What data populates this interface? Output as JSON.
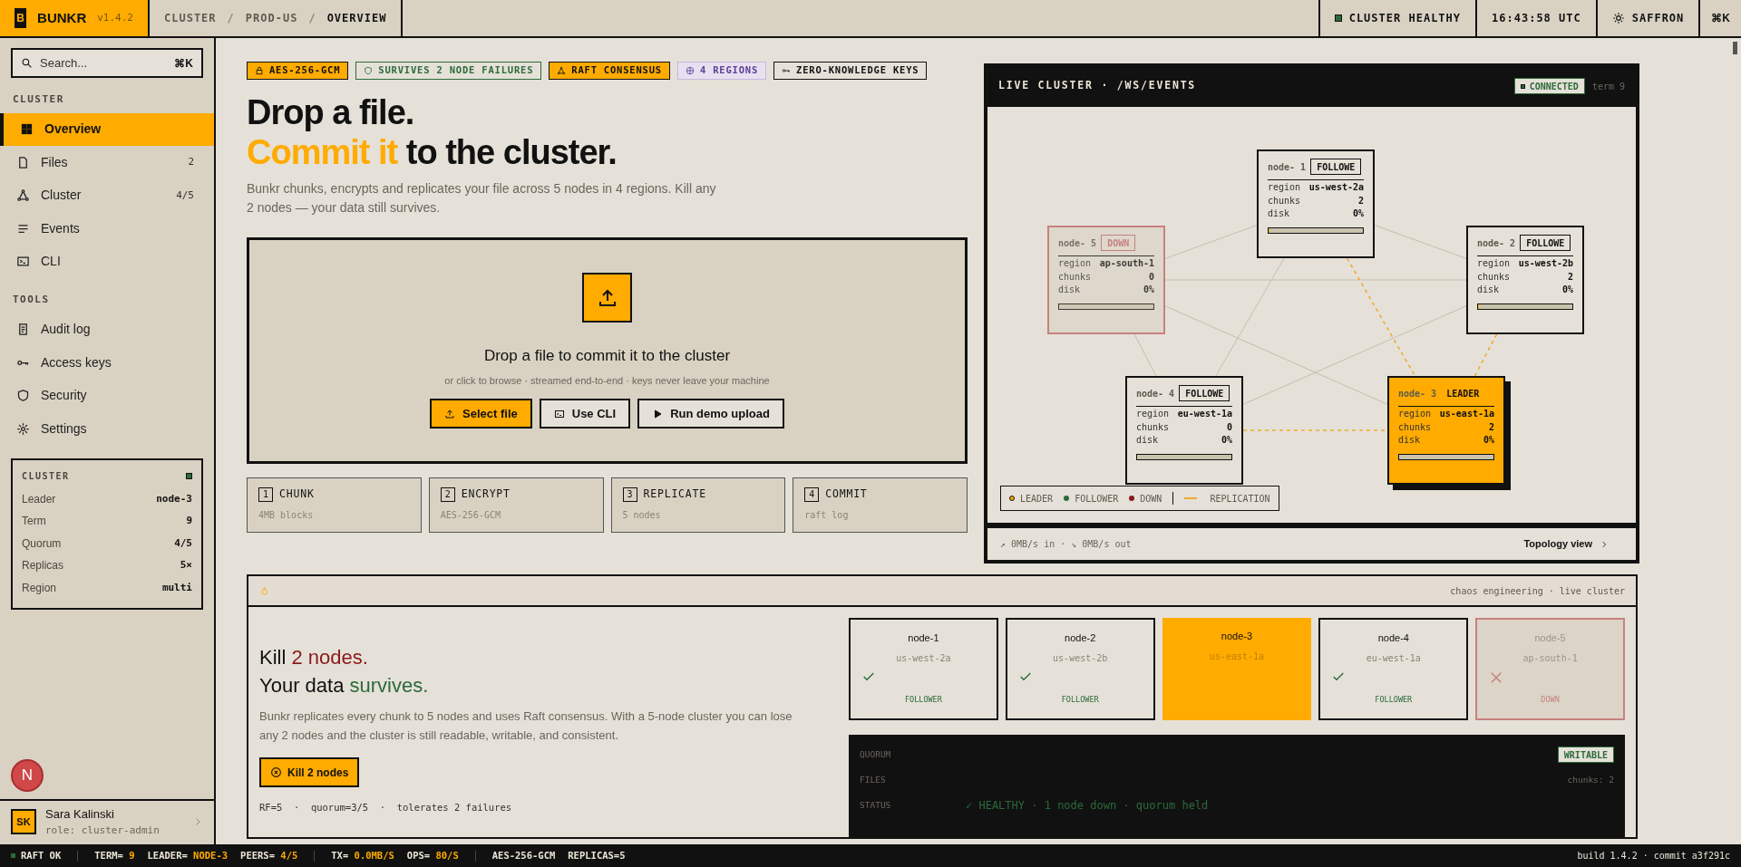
{
  "topbar": {
    "logo": "B",
    "brand": "BUNKR",
    "version": "v1.4.2",
    "breadcrumbs": [
      {
        "label": "CLUSTER",
        "selected": false
      },
      {
        "label": "PROD-US",
        "selected": false
      },
      {
        "label": "OVERVIEW",
        "selected": true
      }
    ],
    "separator": "/",
    "status": "CLUSTER HEALTHY",
    "time": "16:43:58 UTC",
    "theme": "SAFFRON",
    "shortcut": "⌘K"
  },
  "sidebar": {
    "search": {
      "placeholder": "Search...",
      "shortcut": "⌘K"
    },
    "sections": [
      {
        "title": "CLUSTER",
        "items": [
          {
            "label": "Overview",
            "selected": true
          },
          {
            "label": "Files",
            "count": "2",
            "selected": false
          },
          {
            "label": "Cluster",
            "count": "4/5",
            "selected": false
          },
          {
            "label": "Events",
            "selected": false
          },
          {
            "label": "CLI",
            "selected": false
          }
        ]
      },
      {
        "title": "TOOLS",
        "items": [
          {
            "label": "Audit log",
            "selected": false
          },
          {
            "label": "Access keys",
            "selected": false
          },
          {
            "label": "Security",
            "selected": false
          },
          {
            "label": "Settings",
            "selected": false
          }
        ]
      }
    ],
    "cluster_card": {
      "title": "CLUSTER",
      "rows": [
        {
          "label": "Leader",
          "value": "node-3"
        },
        {
          "label": "Term",
          "value": "9"
        },
        {
          "label": "Quorum",
          "value": "4/5"
        },
        {
          "label": "Replicas",
          "value": "5×"
        },
        {
          "label": "Region",
          "value": "multi"
        }
      ]
    },
    "user": {
      "initials": "SK",
      "name": "Sara Kalinski",
      "role": "role: cluster-admin"
    }
  },
  "dev_badge": "N",
  "hero": {
    "badges": [
      {
        "label": "AES-256-GCM",
        "kind": "accent"
      },
      {
        "label": "SURVIVES 2 NODE FAILURES",
        "kind": "success"
      },
      {
        "label": "RAFT CONSENSUS",
        "kind": "accent"
      },
      {
        "label": "4 REGIONS",
        "kind": "info"
      },
      {
        "label": "ZERO-KNOWLEDGE KEYS",
        "kind": "plain"
      }
    ],
    "title_lines": [
      [
        {
          "text": "Drop a file."
        }
      ],
      [
        {
          "text": "Commit it",
          "kind": "accent"
        },
        {
          "text": " to the cluster."
        }
      ]
    ],
    "description": "Bunkr chunks, encrypts and replicates your file across 5 nodes in 4 regions. Kill any 2 nodes — your data still survives.",
    "dropzone": {
      "title": "Drop a file to commit it to the cluster",
      "subtitle": "or click to browse · streamed end-to-end · keys never leave your machine",
      "buttons": [
        {
          "label": "Select file",
          "kind": "primary"
        },
        {
          "label": "Use CLI",
          "kind": "secondary"
        },
        {
          "label": "Run demo upload",
          "kind": "secondary"
        }
      ]
    },
    "steps": [
      {
        "number": "1",
        "title": "CHUNK",
        "detail": "4MB blocks"
      },
      {
        "number": "2",
        "title": "ENCRYPT",
        "detail": "AES-256-GCM"
      },
      {
        "number": "3",
        "title": "REPLICATE",
        "detail": "5 nodes"
      },
      {
        "number": "4",
        "title": "COMMIT",
        "detail": "raft log"
      }
    ]
  },
  "live_cluster": {
    "title": "LIVE CLUSTER · /WS/EVENTS",
    "connection": "CONNECTED",
    "term": "term 9",
    "nodes": [
      {
        "name": "node- 1",
        "role": "FOLLOWE",
        "kind": "follower",
        "rows": [
          {
            "label": "region",
            "value": "us-west-2a"
          },
          {
            "label": "chunks",
            "value": "2"
          },
          {
            "label": "disk",
            "value": "0%"
          }
        ],
        "level": 0.01
      },
      {
        "name": "node- 5",
        "role": "DOWN",
        "kind": "down",
        "rows": [
          {
            "label": "region",
            "value": "ap-south-1"
          },
          {
            "label": "chunks",
            "value": "0"
          },
          {
            "label": "disk",
            "value": "0%"
          }
        ]
      },
      {
        "name": "node- 2",
        "role": "FOLLOWE",
        "kind": "follower",
        "rows": [
          {
            "label": "region",
            "value": "us-west-2b"
          },
          {
            "label": "chunks",
            "value": "2"
          },
          {
            "label": "disk",
            "value": "0%"
          }
        ],
        "level": 0.01
      },
      {
        "name": "node- 4",
        "role": "FOLLOWE",
        "kind": "follower",
        "rows": [
          {
            "label": "region",
            "value": "eu-west-1a"
          },
          {
            "label": "chunks",
            "value": "0"
          },
          {
            "label": "disk",
            "value": "0%"
          }
        ]
      },
      {
        "name": "node- 3",
        "role": "LEADER",
        "kind": "leader",
        "rows": [
          {
            "label": "region",
            "value": "us-east-1a"
          },
          {
            "label": "chunks",
            "value": "2"
          },
          {
            "label": "disk",
            "value": "0%"
          }
        ]
      }
    ],
    "legend": [
      {
        "label": "LEADER",
        "kind": "leader"
      },
      {
        "label": "FOLLOWER",
        "kind": "follower"
      },
      {
        "label": "DOWN",
        "kind": "down"
      },
      {
        "label": "REPLICATION",
        "kind": "replication"
      }
    ],
    "throughput": "↗ 0MB/s in · ↘ 0MB/s out",
    "link": "Topology view"
  },
  "chaos": {
    "tagline": "chaos engineering · live cluster",
    "title_lines": [
      [
        {
          "text": "Kill "
        },
        {
          "text": "2 nodes.",
          "kind": "danger"
        }
      ],
      [
        {
          "text": "Your data "
        },
        {
          "text": "survives.",
          "kind": "success"
        }
      ]
    ],
    "description": "Bunkr replicates every chunk to 5 nodes and uses Raft consensus. With a 5-node cluster you can lose any 2 nodes and the cluster is still readable, writable, and consistent.",
    "button": "Kill 2 nodes",
    "footnote": "RF=5  ·  quorum=3/5  ·  tolerates 2 failures",
    "nodes": [
      {
        "name": "node-1",
        "region": "us-west-2a",
        "status": "FOLLOWER",
        "kind": "follower"
      },
      {
        "name": "node-2",
        "region": "us-west-2b",
        "status": "FOLLOWER",
        "kind": "follower"
      },
      {
        "name": "node-3",
        "region": "us-east-1a",
        "kind": "leader"
      },
      {
        "name": "node-4",
        "region": "eu-west-1a",
        "status": "FOLLOWER",
        "kind": "follower"
      },
      {
        "name": "node-5",
        "region": "ap-south-1",
        "status": "DOWN",
        "kind": "down"
      }
    ],
    "terminal": [
      {
        "label": "QUORUM",
        "value": "WRITABLE",
        "kind": "badge"
      },
      {
        "label": "FILES",
        "value": "chunks: 2",
        "kind": "right"
      },
      {
        "label": "STATUS",
        "value": "✓ HEALTHY · 1 node down · quorum held",
        "kind": "status"
      }
    ]
  },
  "status_bar": {
    "health": "RAFT OK",
    "groups": [
      [
        {
          "label": "TERM=",
          "value": "9"
        },
        {
          "label": "LEADER=",
          "value": "NODE-3"
        },
        {
          "label": "PEERS=",
          "value": "4/5"
        }
      ],
      [
        {
          "label": "TX=",
          "value": "0.0MB/S"
        },
        {
          "label": "OPS=",
          "value": "80/S"
        }
      ],
      [
        {
          "label": "AES-256-GCM"
        },
        {
          "label": "REPLICAS=5"
        }
      ]
    ],
    "build": "build 1.4.2 · commit a3f291c"
  }
}
